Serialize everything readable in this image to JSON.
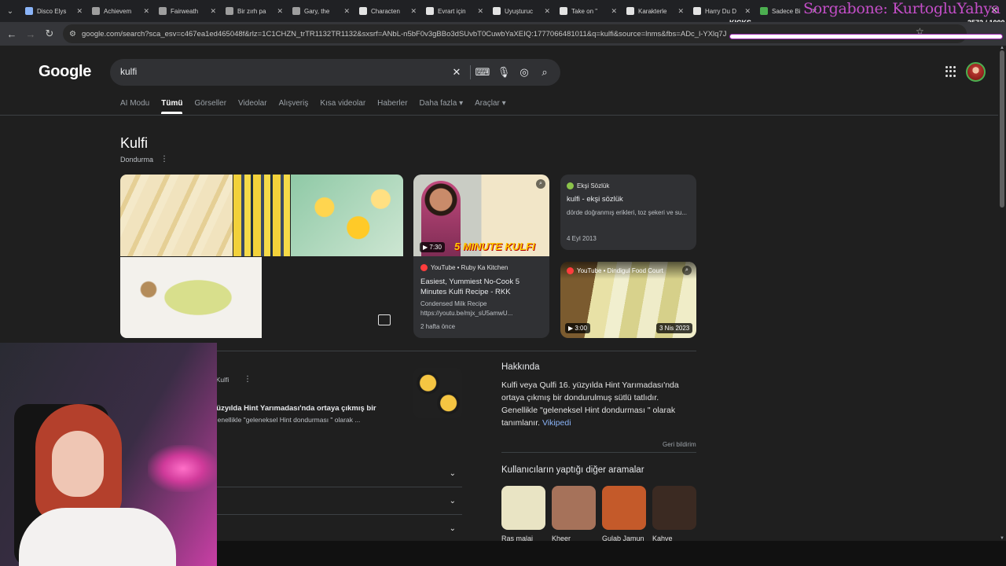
{
  "browser": {
    "tabs": [
      {
        "label": "Disco Elys",
        "color": "#8ab4f8",
        "active": false
      },
      {
        "label": "Achievem",
        "color": "#9e9e9e",
        "active": false
      },
      {
        "label": "Fairweath",
        "color": "#9e9e9e",
        "active": false
      },
      {
        "label": "Bir zırh pa",
        "color": "#9e9e9e",
        "active": false
      },
      {
        "label": "Gary, the",
        "color": "#9e9e9e",
        "active": false
      },
      {
        "label": "Characten",
        "color": "#e3e3e3",
        "active": false
      },
      {
        "label": "Evrart için",
        "color": "#e3e3e3",
        "active": false
      },
      {
        "label": "Uyuşturuc",
        "color": "#e3e3e3",
        "active": false
      },
      {
        "label": "Take on \"",
        "color": "#e3e3e3",
        "active": false
      },
      {
        "label": "Karakterle",
        "color": "#e3e3e3",
        "active": false
      },
      {
        "label": "Harry Du D",
        "color": "#e3e3e3",
        "active": false
      },
      {
        "label": "Sadece Bi",
        "color": "#4caf50",
        "active": false
      }
    ],
    "url": "google.com/search?sca_esv=c467ea1ed465048f&rlz=1C1CHZN_trTR1132TR1132&sxsrf=ANbL-n5bF0v3gBBo3dSUvbT0CuwbYaXEIQ:1777066481011&q=kulfi&source=lnms&fbs=ADc_l-YXlq7J7qtxkolPktrbC4MET..."
  },
  "overlay": {
    "streamer": "Sorgabone: KurtogluYahya",
    "kicks_label": "KICKS",
    "kicks_count": "3572 / 1000"
  },
  "google": {
    "logo": "Google",
    "query": "kulfi",
    "tabs": [
      "AI Modu",
      "Tümü",
      "Görseller",
      "Videolar",
      "Alışveriş",
      "Kısa videolar",
      "Haberler",
      "Daha fazla ▾",
      "Araçlar ▾"
    ],
    "active_tab": "Tümü",
    "kp_title": "Kulfi",
    "kp_subtitle": "Dondurma",
    "yt_card": {
      "duration": "▶ 7:30",
      "banner": "5 MINUTE KULFI",
      "source": "YouTube • Ruby Ka Kitchen",
      "title": "Easiest, Yummiest No-Cook 5 Minutes Kulfi Recipe - RKK",
      "desc": "Condensed Milk Recipe",
      "link": "https://youtu.be/mjx_sU5amwU...",
      "time": "2 hafta önce"
    },
    "ek_card": {
      "source": "Ekşi Sözlük",
      "title": "kulfi - ekşi sözlük",
      "desc": "dörde doğranmış erikleri, toz şekeri ve su...",
      "date": "4 Eyl 2013"
    },
    "yt2_card": {
      "source": "YouTube • Dindigul Food Court",
      "duration": "▶ 3:00",
      "date": "3 Nis 2023"
    },
    "result": {
      "source": "ı Kulfi",
      "title": "yüzyılda Hint Yarımadası'nda ortaya çıkmış bir",
      "snippet": "Genellikle \"geleneksel Hint dondurması \" olarak ..."
    },
    "about": {
      "heading": "Hakkında",
      "text": "Kulfi veya Qulfi 16. yüzyılda Hint Yarımadası'nda ortaya çıkmış bir dondurulmuş sütlü tatlıdır. Genellikle \"geleneksel Hint dondurması \" olarak tanımlanır.",
      "link": "Vikipedi",
      "feedback": "Geri bildirim"
    },
    "others": {
      "heading": "Kullanıcıların yaptığı diğer aramalar",
      "items": [
        {
          "label": "Ras malai",
          "color": "#e9e4c4"
        },
        {
          "label": "Kheer",
          "color": "#a6725a"
        },
        {
          "label": "Gulab Jamun",
          "color": "#c45a2a"
        },
        {
          "label": "Kahve",
          "color": "#3b2a22"
        }
      ]
    }
  }
}
